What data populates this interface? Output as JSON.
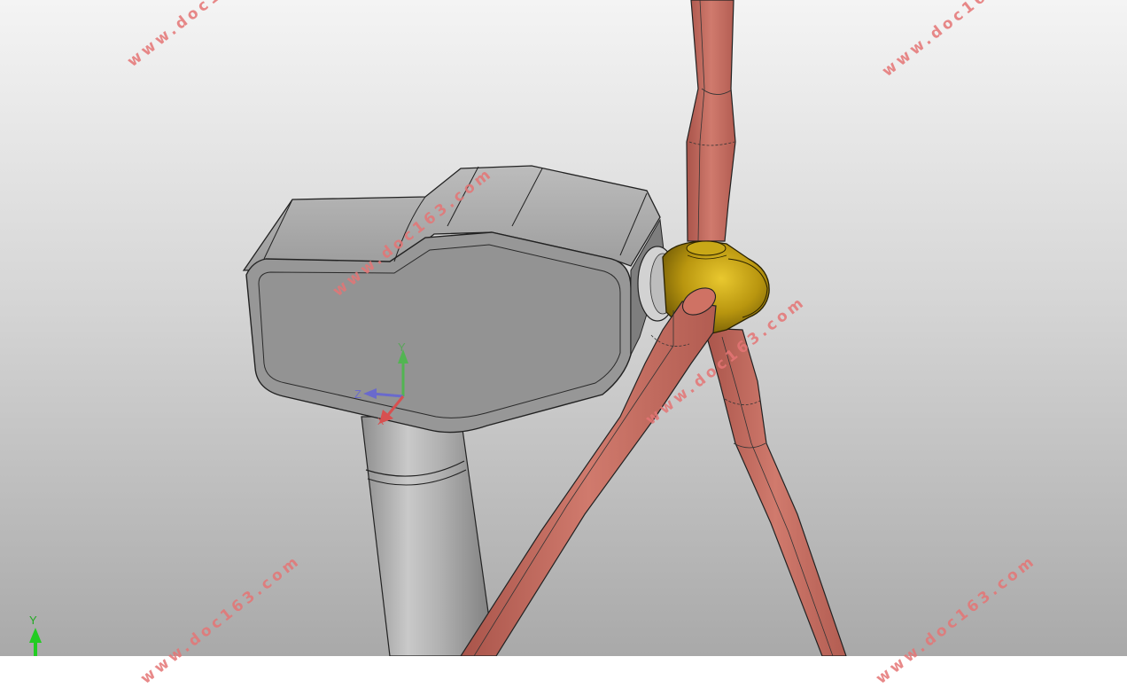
{
  "viewport": {
    "background_top": "#f4f4f4",
    "background_bottom": "#a9a9a9"
  },
  "model": {
    "housing_color": "#9a9a9a",
    "tower_color": "#a2a2a2",
    "hub_color": "#b7960f",
    "blade_color": "#c2685c"
  },
  "watermark": {
    "text": "www.doc163.com",
    "color": "#e57575"
  },
  "triad": {
    "y_label": "Y",
    "z_label": "Z",
    "x_label": "X"
  },
  "corner_triad": {
    "y_label": "Y"
  }
}
